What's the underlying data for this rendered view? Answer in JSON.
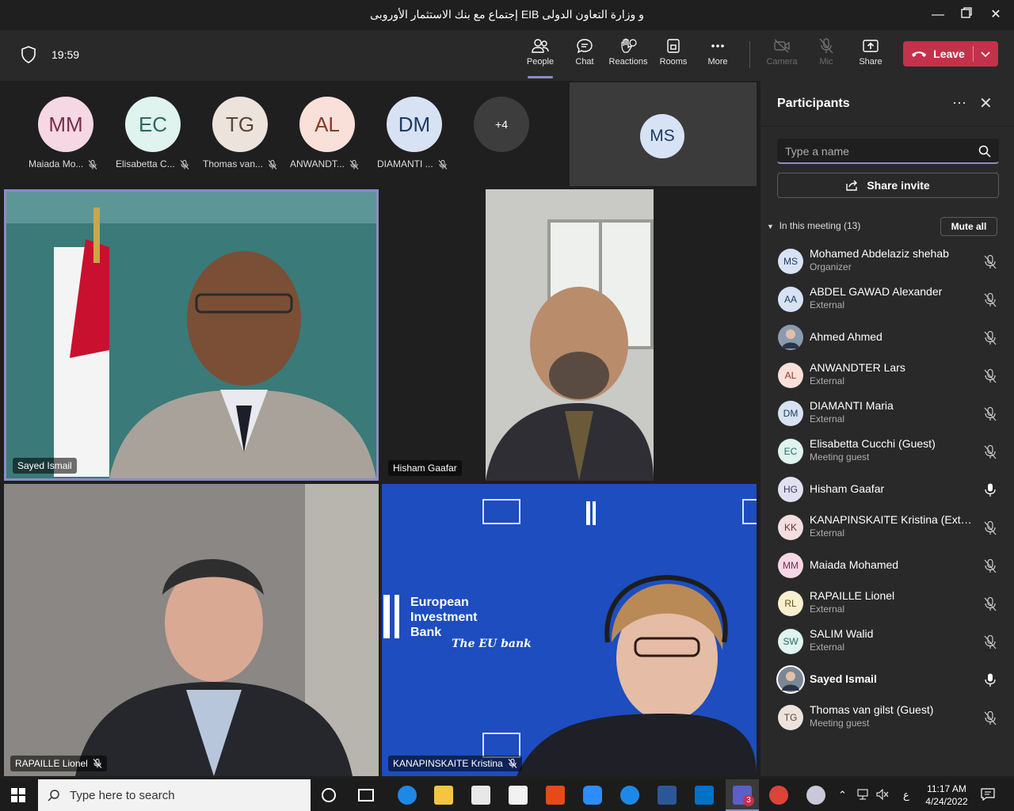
{
  "window": {
    "title": "إجتماع مع بنك الاستثمار الأوروبى EIB و وزارة التعاون الدولى"
  },
  "meeting": {
    "timer": "19:59"
  },
  "toolbar": {
    "people": "People",
    "chat": "Chat",
    "reactions": "Reactions",
    "rooms": "Rooms",
    "more": "More",
    "camera": "Camera",
    "mic": "Mic",
    "share": "Share",
    "leave": "Leave"
  },
  "avatars": [
    {
      "initials": "MM",
      "name": "Maiada Mo...",
      "bg": "#f6d8e4",
      "fg": "#7b2c4a"
    },
    {
      "initials": "EC",
      "name": "Elisabetta C...",
      "bg": "#dff3ef",
      "fg": "#2b6b60"
    },
    {
      "initials": "TG",
      "name": "Thomas van...",
      "bg": "#ece3dd",
      "fg": "#5c4638"
    },
    {
      "initials": "AL",
      "name": "ANWANDT...",
      "bg": "#f9e0d9",
      "fg": "#8a3a26"
    },
    {
      "initials": "DM",
      "name": "DIAMANTI ...",
      "bg": "#d7e3f4",
      "fg": "#1f3a60"
    }
  ],
  "overflow": "+4",
  "ms_tile": {
    "initials": "MS"
  },
  "tiles": {
    "t1": "Sayed Ismail",
    "t2": "Hisham Gaafar",
    "t3": "RAPAILLE Lionel",
    "t4": "KANAPINSKAITE Kristina"
  },
  "eib": {
    "line1": "European",
    "line2": "Investment",
    "line3": "Bank",
    "tag": "The EU bank"
  },
  "panel": {
    "title": "Participants",
    "search_placeholder": "Type a name",
    "share_invite": "Share invite",
    "in_meeting": "In this meeting (13)",
    "mute_all": "Mute all",
    "participants": [
      {
        "initials": "MS",
        "name": "Mohamed Abdelaziz shehab",
        "sub": "Organizer",
        "bg": "#d7e3f4",
        "fg": "#1f3a60",
        "mic": "off"
      },
      {
        "initials": "AA",
        "name": "ABDEL GAWAD Alexander",
        "sub": "External",
        "bg": "#d7e3f4",
        "fg": "#1f3a60",
        "mic": "off"
      },
      {
        "initials": "",
        "name": "Ahmed Ahmed",
        "sub": "",
        "bg": "#8a9bb0",
        "fg": "#fff",
        "mic": "off"
      },
      {
        "initials": "AL",
        "name": "ANWANDTER Lars",
        "sub": "External",
        "bg": "#f9e0d9",
        "fg": "#8a3a26",
        "mic": "off"
      },
      {
        "initials": "DM",
        "name": "DIAMANTI Maria",
        "sub": "External",
        "bg": "#d7e3f4",
        "fg": "#1f3a60",
        "mic": "off"
      },
      {
        "initials": "EC",
        "name": "Elisabetta Cucchi (Guest)",
        "sub": "Meeting guest",
        "bg": "#dff3ef",
        "fg": "#2b6b60",
        "mic": "off"
      },
      {
        "initials": "HG",
        "name": "Hisham Gaafar",
        "sub": "",
        "bg": "#e0e0ef",
        "fg": "#3b3a6b",
        "mic": "on"
      },
      {
        "initials": "KK",
        "name": "KANAPINSKAITE Kristina (Extern...",
        "sub": "External",
        "bg": "#f1dede",
        "fg": "#6b2f2f",
        "mic": "off"
      },
      {
        "initials": "MM",
        "name": "Maiada Mohamed",
        "sub": "",
        "bg": "#f6d8e4",
        "fg": "#7b2c4a",
        "mic": "off"
      },
      {
        "initials": "RL",
        "name": "RAPAILLE Lionel",
        "sub": "External",
        "bg": "#f9efcf",
        "fg": "#6b5213",
        "mic": "off"
      },
      {
        "initials": "SW",
        "name": "SALIM Walid",
        "sub": "External",
        "bg": "#dff3ef",
        "fg": "#2b6b60",
        "mic": "off"
      },
      {
        "initials": "",
        "name": "Sayed Ismail",
        "sub": "",
        "bg": "#7b8696",
        "fg": "#fff",
        "mic": "on",
        "bold": true
      },
      {
        "initials": "TG",
        "name": "Thomas van gilst (Guest)",
        "sub": "Meeting guest",
        "bg": "#ece3dd",
        "fg": "#5c4638",
        "mic": "off"
      }
    ]
  },
  "taskbar": {
    "search_placeholder": "Type here to search",
    "time": "11:17 AM",
    "date": "4/24/2022",
    "lang": "ع",
    "teams_badge": "3"
  }
}
